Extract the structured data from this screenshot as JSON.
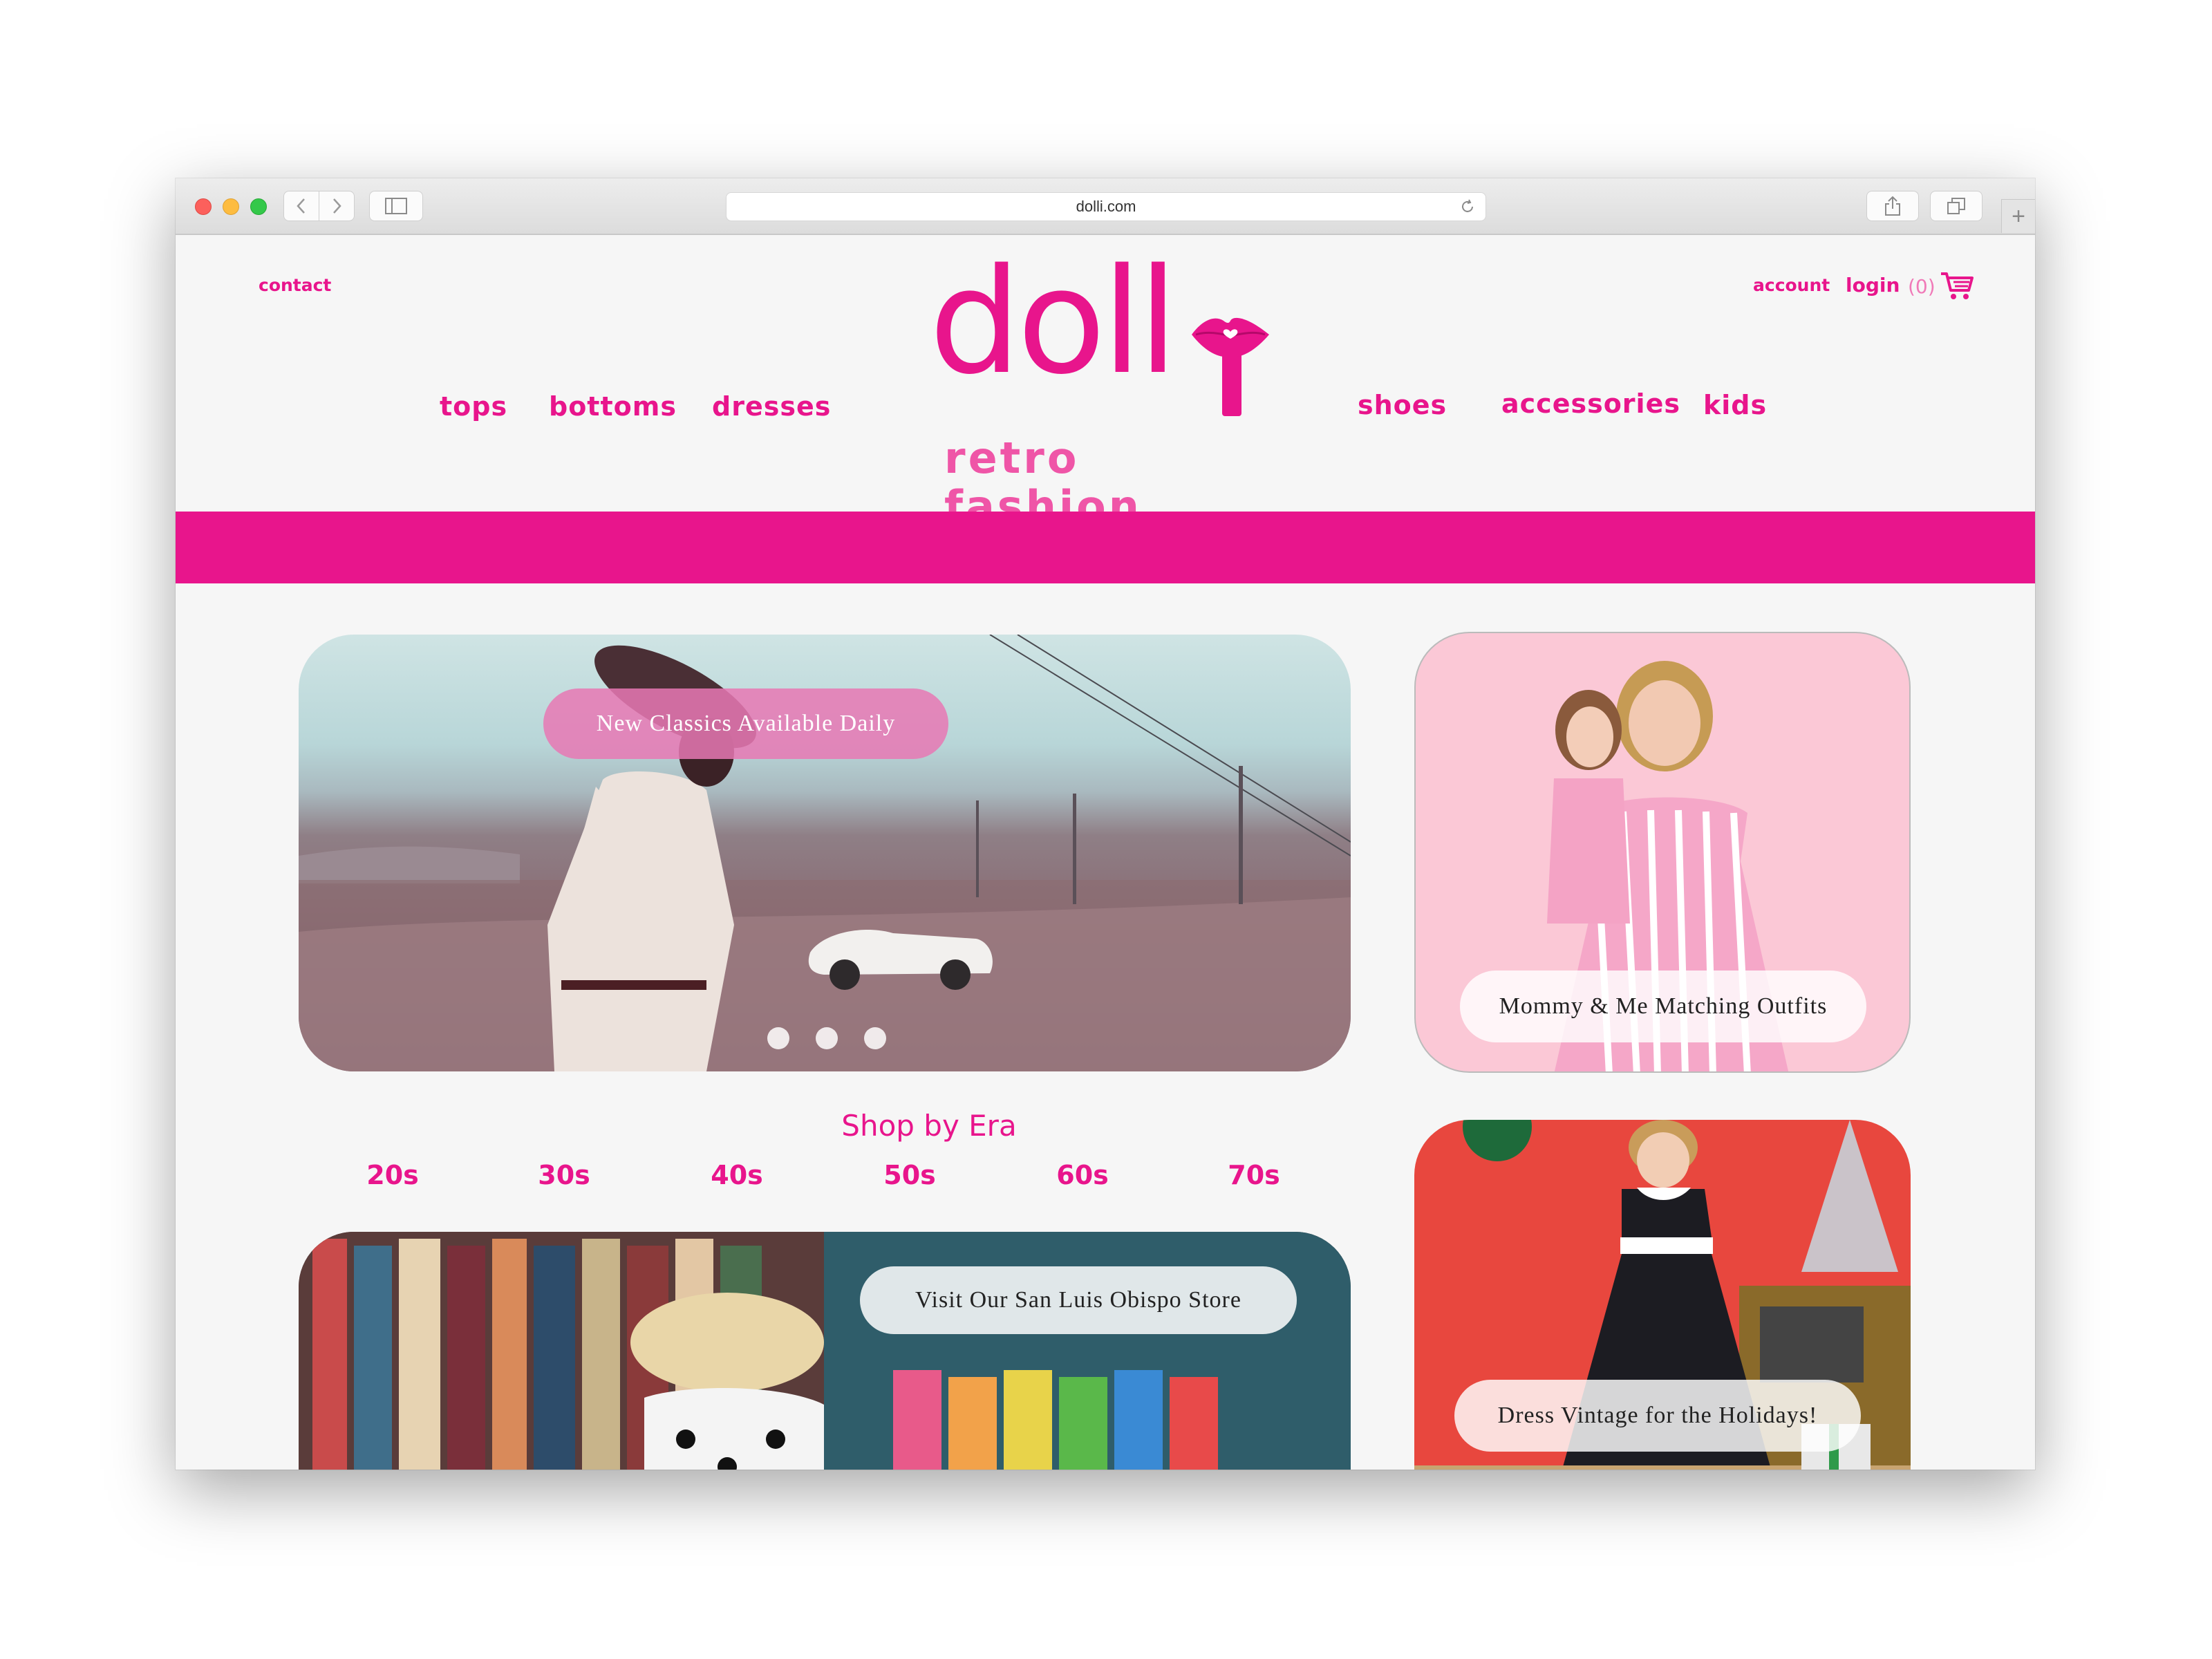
{
  "browser": {
    "url": "dolli.com"
  },
  "header": {
    "contact": "contact",
    "account": "account",
    "login": "login",
    "cart_count": "(0)",
    "logo_word": "doll",
    "logo_tagline": "retro fashion"
  },
  "nav": {
    "left": [
      "tops",
      "bottoms",
      "dresses"
    ],
    "right": [
      "shoes",
      "accessories",
      "kids"
    ]
  },
  "hero": {
    "caption": "New Classics Available Daily",
    "slides": 3,
    "active_slide": 1
  },
  "promo_cards": {
    "mommy_me": "Mommy & Me Matching Outfits",
    "store": "Visit Our San Luis Obispo Store",
    "holidays": "Dress Vintage for the Holidays!"
  },
  "shop_by_era": {
    "title": "Shop by Era",
    "eras": [
      "20s",
      "30s",
      "40s",
      "50s",
      "60s",
      "70s"
    ]
  },
  "colors": {
    "brand_pink": "#e8158c",
    "light_pink": "#ef8cc0",
    "background": "#f6f6f6"
  },
  "icons": [
    "back-arrow-icon",
    "forward-arrow-icon",
    "sidebar-icon",
    "reload-icon",
    "share-icon",
    "tabs-icon",
    "new-tab-icon",
    "cart-icon",
    "lips-icon"
  ]
}
